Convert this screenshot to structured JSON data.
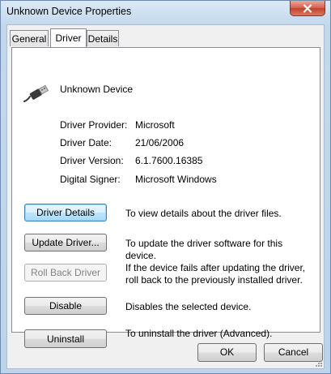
{
  "window": {
    "title": "Unknown Device Properties"
  },
  "tabs": [
    {
      "label": "General",
      "active": false
    },
    {
      "label": "Driver",
      "active": true
    },
    {
      "label": "Details",
      "active": false
    }
  ],
  "device": {
    "name": "Unknown Device",
    "icon": "usb-plug-icon"
  },
  "properties": [
    {
      "label": "Driver Provider:",
      "value": "Microsoft"
    },
    {
      "label": "Driver Date:",
      "value": "21/06/2006"
    },
    {
      "label": "Driver Version:",
      "value": "6.1.7600.16385"
    },
    {
      "label": "Digital Signer:",
      "value": "Microsoft Windows"
    }
  ],
  "actions": [
    {
      "label": "Driver Details",
      "description": "To view details about the driver files.",
      "enabled": true,
      "focused": true
    },
    {
      "label": "Update Driver...",
      "description": "To update the driver software for this device.",
      "enabled": true
    },
    {
      "label": "Roll Back Driver",
      "description": "If the device fails after updating the driver, roll back to the previously installed driver.",
      "enabled": false
    },
    {
      "label": "Disable",
      "description": "Disables the selected device.",
      "enabled": true
    },
    {
      "label": "Uninstall",
      "description": "To uninstall the driver (Advanced).",
      "enabled": true
    }
  ],
  "footer": {
    "ok_label": "OK",
    "cancel_label": "Cancel"
  },
  "colors": {
    "title_bar": "#c3d8ec",
    "close_button": "#c2412b",
    "focus_border": "#3c7fb1"
  }
}
